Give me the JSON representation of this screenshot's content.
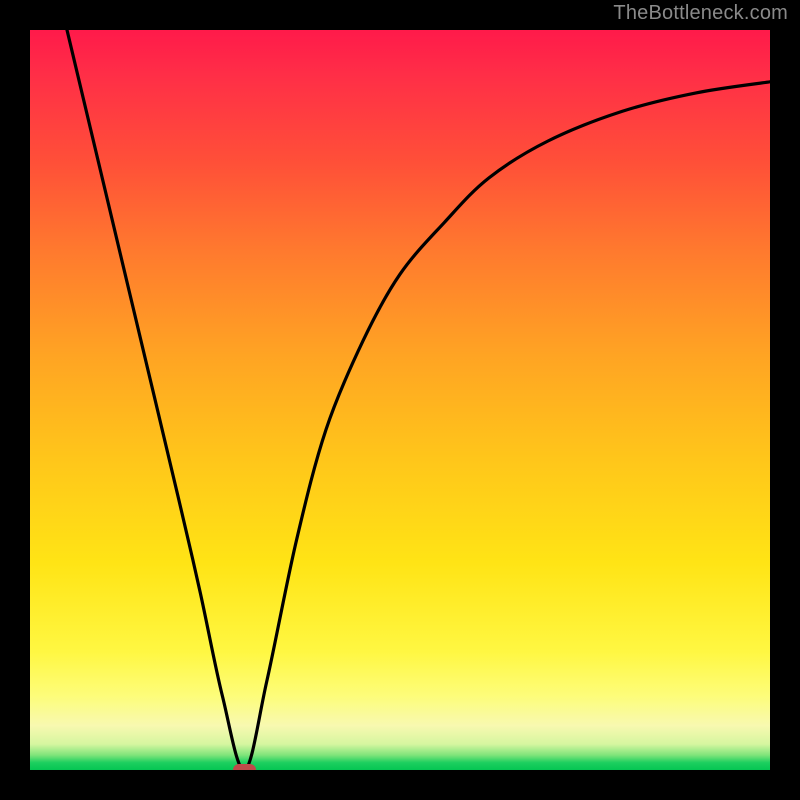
{
  "watermark": "TheBottleneck.com",
  "colors": {
    "page_bg": "#000000",
    "watermark_text": "#8a8a8a",
    "curve_stroke": "#000000",
    "marker_fill": "#bf4a4a",
    "gradient_top": "#ff1a4a",
    "gradient_bottom": "#05c653"
  },
  "chart_data": {
    "type": "line",
    "title": "",
    "xlabel": "",
    "ylabel": "",
    "xlim": [
      0,
      100
    ],
    "ylim": [
      0,
      100
    ],
    "grid": false,
    "legend": false,
    "note": "No axis ticks or labels are visible; values are estimated on a 0–100 normalized scale in each dimension.",
    "series": [
      {
        "name": "bottleneck-curve",
        "x": [
          5,
          10,
          15,
          20,
          23,
          26,
          29,
          32,
          36,
          40,
          45,
          50,
          56,
          62,
          70,
          80,
          90,
          100
        ],
        "y": [
          100,
          79,
          58,
          37,
          24,
          10,
          0,
          12,
          31,
          46,
          58,
          67,
          74,
          80,
          85,
          89,
          91.5,
          93
        ]
      }
    ],
    "annotations": [
      {
        "name": "min-marker",
        "shape": "pill",
        "x": 29,
        "y": 0,
        "width_pct": 3.2,
        "height_pct": 1.6,
        "color": "#bf4a4a"
      }
    ]
  }
}
